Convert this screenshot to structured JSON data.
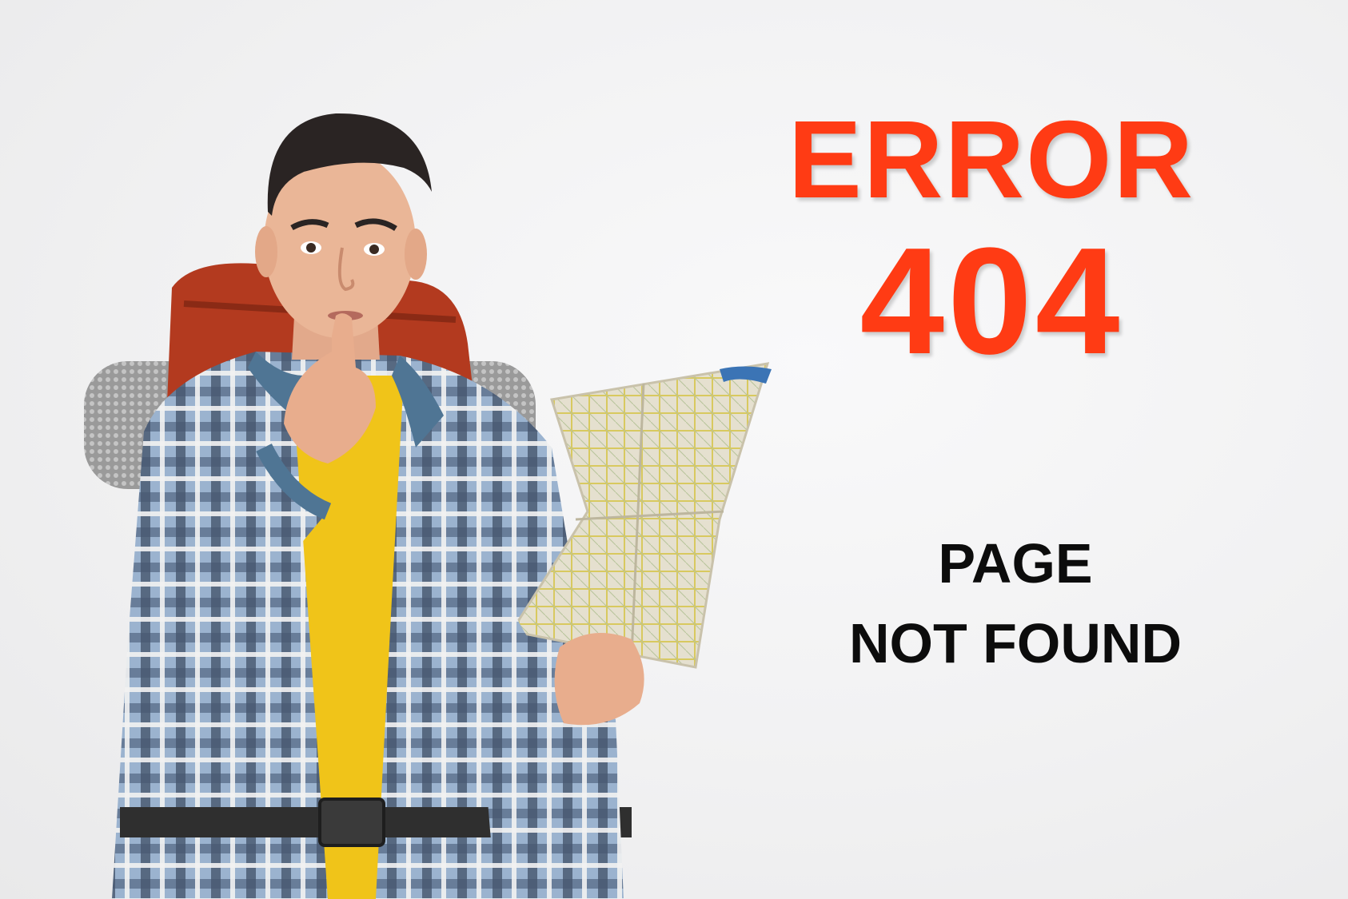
{
  "error": {
    "word": "ERROR",
    "code": "404",
    "message_line1": "PAGE",
    "message_line2": "NOT FOUND"
  },
  "colors": {
    "accent": "#ff3b14",
    "message_text": "#0c0c0c",
    "background": "#f2f2f3"
  },
  "illustration": {
    "icon": "backpacker-with-map-photo"
  }
}
